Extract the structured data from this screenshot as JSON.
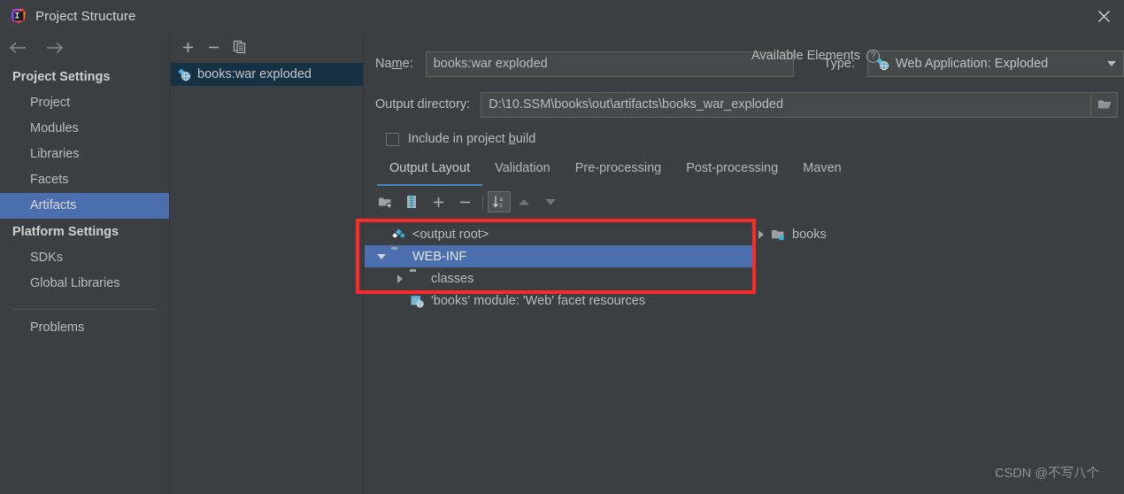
{
  "window": {
    "title": "Project Structure",
    "app_icon": "intellij-idea-logo",
    "close_icon": "close-icon"
  },
  "nav": {
    "back_icon": "arrow-left-icon",
    "forward_icon": "arrow-right-icon"
  },
  "sidebar": {
    "groups": [
      {
        "label": "Project Settings",
        "items": [
          {
            "label": "Project",
            "selected": false
          },
          {
            "label": "Modules",
            "selected": false
          },
          {
            "label": "Libraries",
            "selected": false
          },
          {
            "label": "Facets",
            "selected": false
          },
          {
            "label": "Artifacts",
            "selected": true
          }
        ]
      },
      {
        "label": "Platform Settings",
        "items": [
          {
            "label": "SDKs",
            "selected": false
          },
          {
            "label": "Global Libraries",
            "selected": false
          }
        ]
      }
    ],
    "footer_items": [
      {
        "label": "Problems"
      }
    ]
  },
  "artifacts_panel": {
    "toolbar": [
      {
        "name": "add-artifact-button",
        "icon": "plus-icon"
      },
      {
        "name": "remove-artifact-button",
        "icon": "minus-icon"
      },
      {
        "name": "copy-artifact-button",
        "icon": "copy-icon"
      }
    ],
    "items": [
      {
        "label": "books:war exploded",
        "icon": "web-artifact-icon",
        "selected": true
      }
    ]
  },
  "details": {
    "name_label": "Name:",
    "name_mnemonic": "m",
    "name_value": "books:war exploded",
    "type_label": "Type:",
    "type_value": "Web Application: Exploded",
    "type_icon": "web-artifact-icon",
    "output_label": "Output directory:",
    "output_value": "D:\\10.SSM\\books\\out\\artifacts\\books_war_exploded",
    "browse_icon": "folder-open-icon",
    "include_checkbox_label": "Include in project build",
    "include_checkbox_mnemonic": "b",
    "include_checked": false
  },
  "tabs": [
    {
      "label": "Output Layout",
      "active": true
    },
    {
      "label": "Validation",
      "active": false
    },
    {
      "label": "Pre-processing",
      "active": false
    },
    {
      "label": "Post-processing",
      "active": false
    },
    {
      "label": "Maven",
      "active": false
    }
  ],
  "tree_toolbar": [
    {
      "name": "create-directory-button",
      "icon": "new-folder-icon",
      "disabled": false
    },
    {
      "name": "create-archive-button",
      "icon": "archive-icon",
      "disabled": false
    },
    {
      "name": "add-copy-of-button",
      "icon": "plus-icon",
      "disabled": false
    },
    {
      "name": "remove-button",
      "icon": "minus-icon",
      "disabled": false
    },
    {
      "name": "sort-by-name-button",
      "icon": "sort-az-icon",
      "disabled": false,
      "toggled": true
    },
    {
      "name": "move-up-button",
      "icon": "arrow-up-icon",
      "disabled": true
    },
    {
      "name": "move-down-button",
      "icon": "arrow-down-icon",
      "disabled": true
    }
  ],
  "available_elements": {
    "title": "Available Elements",
    "help_icon": "help-icon",
    "help_glyph": "?",
    "items": [
      {
        "label": "books",
        "icon": "module-folder-icon",
        "expandable": true,
        "expanded": false,
        "indent": 0
      }
    ]
  },
  "output_layout_tree": [
    {
      "label": "<output root>",
      "icon": "artifact-root-icon",
      "expandable": false,
      "indent": 0,
      "selected": false
    },
    {
      "label": "WEB-INF",
      "icon": "folder-icon",
      "expandable": true,
      "expanded": true,
      "indent": 0,
      "selected": true
    },
    {
      "label": "classes",
      "icon": "folder-icon",
      "expandable": true,
      "expanded": false,
      "indent": 1,
      "selected": false
    },
    {
      "label": "'books' module: 'Web' facet resources",
      "icon": "facet-resources-icon",
      "expandable": false,
      "indent": 1,
      "selected": false
    }
  ],
  "annotation": {
    "highlight_color": "#fb2b2b"
  },
  "watermark": "CSDN @不写八个",
  "colors": {
    "background": "#3c3f41",
    "selection_blue": "#4b6eaf",
    "list_selection": "#163044",
    "tab_underline": "#4a88c7",
    "field_background": "#45494a",
    "text": "#bbbbbb"
  }
}
